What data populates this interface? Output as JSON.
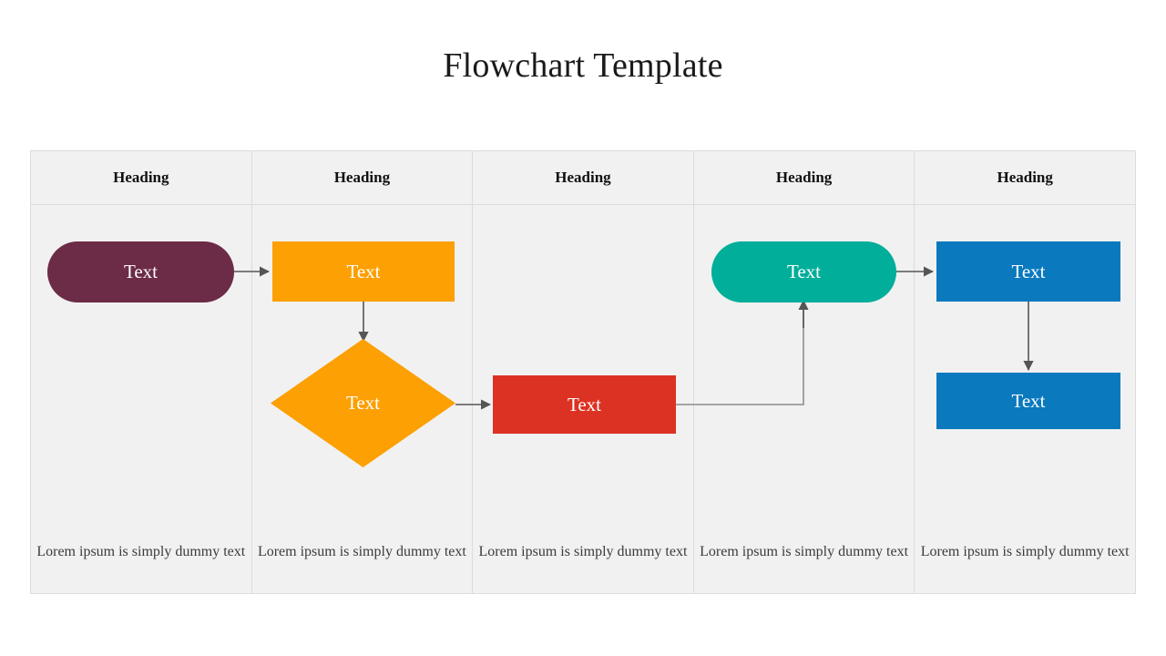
{
  "title": "Flowchart Template",
  "table": {
    "columns": [
      {
        "heading": "Heading",
        "caption": "Lorem ipsum is simply dummy text"
      },
      {
        "heading": "Heading",
        "caption": "Lorem ipsum is simply dummy text"
      },
      {
        "heading": "Heading",
        "caption": "Lorem ipsum is simply dummy text"
      },
      {
        "heading": "Heading",
        "caption": "Lorem ipsum is simply dummy text"
      },
      {
        "heading": "Heading",
        "caption": "Lorem ipsum is simply dummy text"
      }
    ]
  },
  "flow": {
    "nodes": [
      {
        "id": "start",
        "label": "Text",
        "shape": "pill",
        "color": "#6C2B47",
        "column": 1
      },
      {
        "id": "process-1",
        "label": "Text",
        "shape": "rect",
        "color": "#FCA003",
        "column": 2
      },
      {
        "id": "decision",
        "label": "Text",
        "shape": "diamond",
        "color": "#FCA003",
        "column": 2
      },
      {
        "id": "process-2",
        "label": "Text",
        "shape": "rect",
        "color": "#DC3223",
        "column": 3
      },
      {
        "id": "process-3",
        "label": "Text",
        "shape": "pill",
        "color": "#00AE9A",
        "column": 4
      },
      {
        "id": "process-4",
        "label": "Text",
        "shape": "rect",
        "color": "#0A79BE",
        "column": 5
      },
      {
        "id": "end",
        "label": "Text",
        "shape": "rect",
        "color": "#0A79BE",
        "column": 5
      }
    ],
    "connector_color": "#555555",
    "connector_color_alt": "#9a9a9a"
  },
  "theme": {
    "page_background": "#FFFFFF",
    "table_background": "#F1F1F1",
    "grid_line": "#DCDCDC",
    "title_color": "#1A1A1A",
    "heading_color": "#111111",
    "caption_color": "#3B3B3B",
    "shape_text_color": "#FFFFFF"
  }
}
